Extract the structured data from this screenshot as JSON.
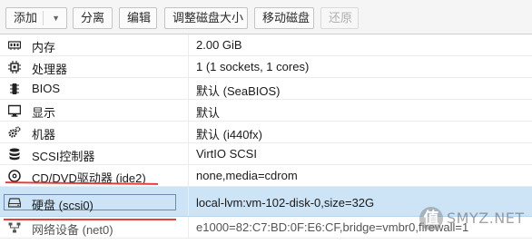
{
  "toolbar": {
    "add_label": "添加",
    "detach_label": "分离",
    "edit_label": "编辑",
    "resize_label": "调整磁盘大小",
    "move_label": "移动磁盘",
    "revert_label": "还原"
  },
  "hardware": [
    {
      "icon": "memory-icon",
      "name": "内存",
      "value": "2.00 GiB"
    },
    {
      "icon": "cpu-icon",
      "name": "处理器",
      "value": "1 (1 sockets, 1 cores)"
    },
    {
      "icon": "bios-chip-icon",
      "name": "BIOS",
      "value": "默认 (SeaBIOS)"
    },
    {
      "icon": "monitor-icon",
      "name": "显示",
      "value": "默认"
    },
    {
      "icon": "gears-icon",
      "name": "机器",
      "value": "默认 (i440fx)"
    },
    {
      "icon": "database-icon",
      "name": "SCSI控制器",
      "value": "VirtIO SCSI"
    },
    {
      "icon": "cdrom-icon",
      "name": "CD/DVD驱动器 (ide2)",
      "value": "none,media=cdrom"
    },
    {
      "icon": "hard-disk-icon",
      "name": "硬盘 (scsi0)",
      "value": "local-lvm:vm-102-disk-0,size=32G"
    },
    {
      "icon": "network-icon",
      "name": "网络设备 (net0)",
      "value": "e1000=82:C7:BD:0F:E6:CF,bridge=vmbr0,firewall=1"
    }
  ],
  "watermark": {
    "glyph": "值",
    "text": "SMYZ.NET"
  },
  "colors": {
    "selected_row": "#cde3f6",
    "annotation_red": "#e2403a"
  }
}
